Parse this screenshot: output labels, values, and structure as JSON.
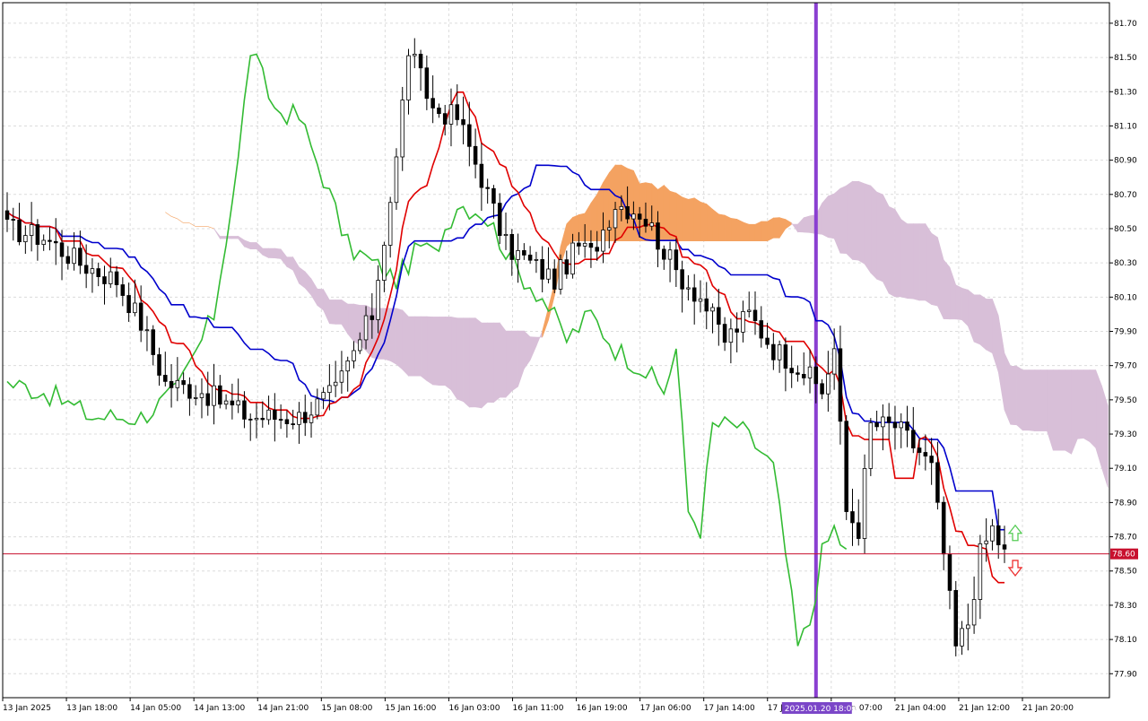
{
  "chart_data": {
    "type": "candlestick",
    "title": "",
    "y_axis": {
      "range": [
        77.76,
        81.82
      ],
      "ticks": [
        "81.70",
        "81.50",
        "81.30",
        "81.10",
        "80.90",
        "80.70",
        "80.50",
        "80.30",
        "80.10",
        "79.90",
        "79.70",
        "79.50",
        "79.30",
        "79.10",
        "78.90",
        "78.70",
        "78.50",
        "78.30",
        "78.10",
        "77.90"
      ],
      "position": "right"
    },
    "x_axis": {
      "ticks": [
        "13 Jan 2025",
        "13 Jan 18:00",
        "14 Jan 05:00",
        "14 Jan 13:00",
        "14 Jan 21:00",
        "15 Jan 08:00",
        "15 Jan 16:00",
        "16 Jan 03:00",
        "16 Jan 11:00",
        "16 Jan 19:00",
        "17 Jan 06:00",
        "17 Jan 14:00",
        "17 Jan 22:00",
        "20 Jan 07:00",
        "21 Jan 04:00",
        "21 Jan 12:00",
        "21 Jan 20:00"
      ],
      "highlight_label": "2025.01.20 18:00",
      "highlight_color": "#7b46c8"
    },
    "grid": true,
    "bar_count": 165,
    "current_price": {
      "label": "78.60",
      "value": 78.6,
      "color": "#c8102e"
    },
    "colors": {
      "bull": "#000000",
      "bear": "#000000",
      "bull_fill": "#ffffff",
      "bear_fill": "#000000",
      "kumo_up": "#f4a261",
      "kumo_down": "#d8bfd8",
      "tenkan": "#e00000",
      "kijun": "#0000cc",
      "chikou": "#33bb33",
      "vline": "#8a3fd1",
      "grid": "#dcdcdc"
    },
    "indicators": [
      {
        "name": "tenkan",
        "color": "#e00000"
      },
      {
        "name": "kijun",
        "color": "#0000cc"
      },
      {
        "name": "chikou",
        "color": "#33bb33"
      },
      {
        "name": "senkou_span_a"
      },
      {
        "name": "senkou_span_b"
      }
    ],
    "markers": [
      {
        "name": "buy-arrow",
        "color": "#55cc55"
      },
      {
        "name": "sell-arrow",
        "color": "#ee3333"
      }
    ]
  }
}
